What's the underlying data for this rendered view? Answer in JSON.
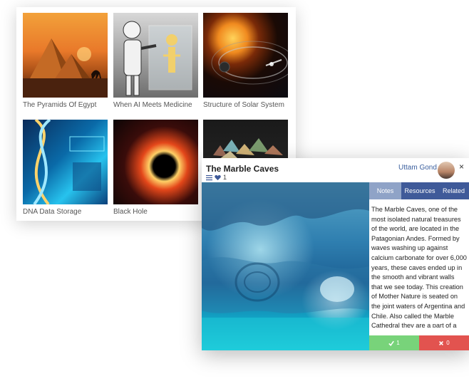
{
  "gallery": {
    "items": [
      {
        "caption": "The Pyramids Of Egypt"
      },
      {
        "caption": "When AI Meets Medicine"
      },
      {
        "caption": "Structure of Solar System"
      },
      {
        "caption": "DNA Data Storage"
      },
      {
        "caption": "Black Hole"
      },
      {
        "caption": ""
      }
    ]
  },
  "modal": {
    "title": "The Marble Caves",
    "like_count": "1",
    "author": "Uttam Gond",
    "close_symbol": "×",
    "tabs": [
      {
        "label": "Notes",
        "active": true
      },
      {
        "label": "Resources",
        "active": false
      },
      {
        "label": "Related",
        "active": false
      }
    ],
    "notes": "The Marble Caves, one of the most isolated natural treasures of the world, are located in the Patagonian Andes. Formed by waves washing up against calcium carbonate for over 6,000 years, these caves ended up in the smooth and vibrant walls that we see today. This creation of Mother Nature is seated on the joint waters of Argentina and Chile. Also called the Marble Cathedral they are a part of a peninsula made of solid marble and is",
    "upvote_count": "1",
    "downvote_count": "0"
  },
  "colors": {
    "tab_bg": "#3f5a99",
    "tab_active": "#8fa3c7",
    "author_link": "#3b5f9e",
    "upvote": "#78d37a",
    "downvote": "#e2534f"
  }
}
